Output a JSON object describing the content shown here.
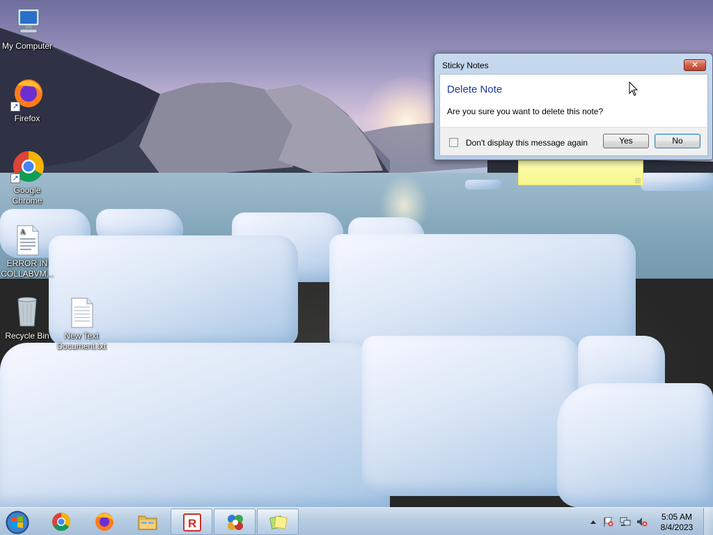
{
  "desktop": {
    "icons": [
      {
        "label": "My Computer"
      },
      {
        "label": "Firefox"
      },
      {
        "label": "Google Chrome"
      },
      {
        "label": "ERROR IN COLLABVM..."
      },
      {
        "label": "Recycle Bin"
      },
      {
        "label": "New Text Document.txt"
      }
    ]
  },
  "dialog": {
    "title": "Sticky Notes",
    "close_glyph": "✕",
    "heading": "Delete Note",
    "message": "Are you sure you want to delete this note?",
    "checkbox_label": "Don't display this message again",
    "checkbox_checked": false,
    "yes_label": "Yes",
    "no_label": "No"
  },
  "taskbar": {
    "pinned": [
      {
        "icon": "start-orb-icon"
      },
      {
        "icon": "chrome-icon"
      },
      {
        "icon": "firefox-icon"
      },
      {
        "icon": "file-explorer-icon"
      },
      {
        "icon": "roblox-icon"
      },
      {
        "icon": "sticky-notes-app-icon"
      },
      {
        "icon": "sticky-notes-icon"
      }
    ],
    "tray_icons": [
      "show-hidden-icons-arrow",
      "action-center-flag-icon",
      "network-icon",
      "volume-muted-icon"
    ],
    "clock": {
      "time": "5:05 AM",
      "date": "8/4/2023"
    }
  },
  "colors": {
    "dialog_heading": "#1e3aa0",
    "close_button": "#c2402a",
    "sticky_note": "#f7f78c",
    "taskbar": "#b7cde2"
  }
}
